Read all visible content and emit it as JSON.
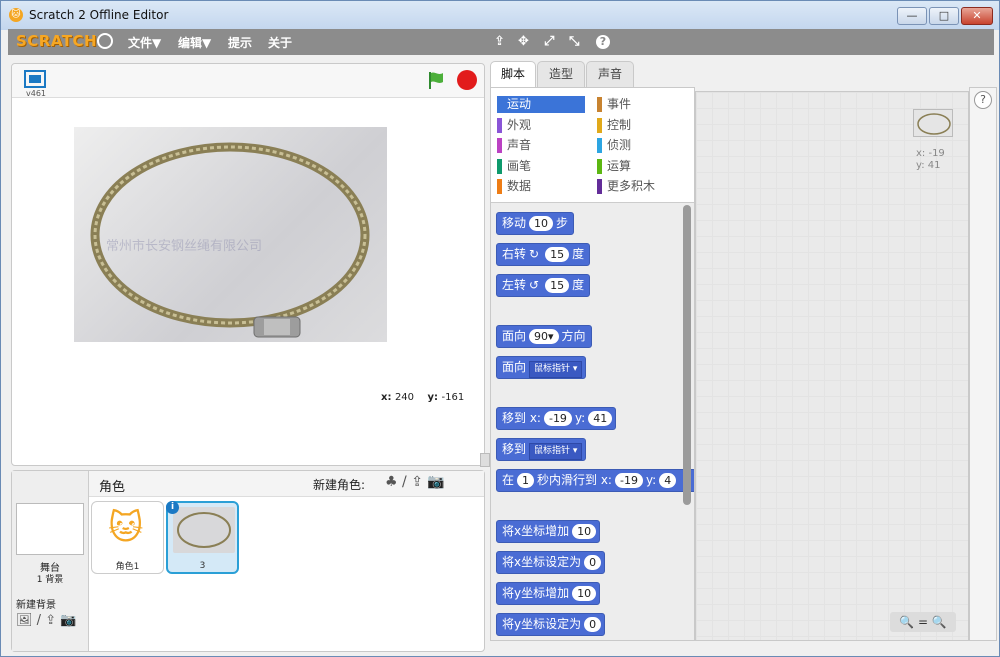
{
  "window": {
    "title": "Scratch 2 Offline Editor",
    "minimize": "—",
    "maximize": "□",
    "close": "✕"
  },
  "menubar": {
    "logo": "SCRATCH",
    "file": "文件▼",
    "edit": "编辑▼",
    "tips": "提示",
    "about": "关于",
    "tools": [
      "⇪",
      "✥",
      "⤢",
      "⤡",
      "?"
    ]
  },
  "stage": {
    "version": "v461",
    "x_label": "x:",
    "x_value": "240",
    "y_label": "y:",
    "y_value": "-161",
    "watermark": "常州市长安钢丝绳有限公司"
  },
  "sprites": {
    "header": "角色",
    "new_sprite_label": "新建角色:",
    "stage_label": "舞台",
    "stage_sub": "1 背景",
    "new_backdrop": "新建背景",
    "items": [
      {
        "label": "角色1"
      },
      {
        "label": "3"
      }
    ],
    "info_badge": "i"
  },
  "tabs": [
    {
      "label": "脚本"
    },
    {
      "label": "造型"
    },
    {
      "label": "声音"
    }
  ],
  "categories": [
    {
      "label": "运动",
      "color": "#4a6cd4"
    },
    {
      "label": "外观",
      "color": "#8a55d7"
    },
    {
      "label": "声音",
      "color": "#bb42c3"
    },
    {
      "label": "画笔",
      "color": "#0e9a6c"
    },
    {
      "label": "数据",
      "color": "#ee7d16"
    },
    {
      "label": "事件",
      "color": "#c88330"
    },
    {
      "label": "控制",
      "color": "#e1a91a"
    },
    {
      "label": "侦测",
      "color": "#2ca5e2"
    },
    {
      "label": "运算",
      "color": "#5cb712"
    },
    {
      "label": "更多积木",
      "color": "#632d99"
    }
  ],
  "blocks": [
    {
      "pre": "移动",
      "arg": "10",
      "post": "步"
    },
    {
      "pre": "右转",
      "icon": "↻",
      "arg": "15",
      "post": "度"
    },
    {
      "pre": "左转",
      "icon": "↺",
      "arg": "15",
      "post": "度"
    },
    {
      "pre": "面向",
      "arg": "90▾",
      "post": "方向"
    },
    {
      "pre": "面向",
      "dd": "鼠标指针 ▾"
    },
    {
      "pre": "移到 x:",
      "arg": "-19",
      "mid": "y:",
      "arg2": "41"
    },
    {
      "pre": "移到",
      "dd": "鼠标指针 ▾"
    },
    {
      "pre": "在",
      "arg": "1",
      "mid": "秒内滑行到 x:",
      "arg2": "-19",
      "mid2": "y:",
      "arg3": "4"
    },
    {
      "pre": "将x坐标增加",
      "arg": "10"
    },
    {
      "pre": "将x坐标设定为",
      "arg": "0"
    },
    {
      "pre": "将y坐标增加",
      "arg": "10"
    },
    {
      "pre": "将y坐标设定为",
      "arg": "0"
    }
  ],
  "scripts": {
    "x_label": "x: -19",
    "y_label": "y: 41",
    "zoom": "🔍 = 🔍"
  },
  "help": "?"
}
